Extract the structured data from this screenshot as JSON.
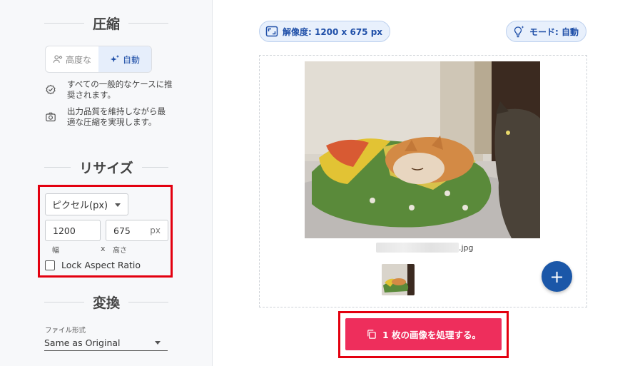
{
  "compression": {
    "title": "圧縮",
    "modes": [
      {
        "label": "高度な",
        "icon": "advanced-user-icon"
      },
      {
        "label": "自動",
        "icon": "sparkle-icon"
      }
    ],
    "active_mode": "自動",
    "features": [
      {
        "icon": "verified-badge-icon",
        "text": "すべての一般的なケースに推奨されます。"
      },
      {
        "icon": "camera-icon",
        "text": "出力品質を維持しながら最適な圧縮を実現します。"
      }
    ]
  },
  "resize": {
    "title": "リサイズ",
    "unit_select": "ピクセル(px)",
    "width_value": "1200",
    "height_value": "675",
    "height_unit": "px",
    "width_label": "幅",
    "separator": "x",
    "height_label": "高さ",
    "lock_aspect_label": "Lock Aspect Ratio",
    "lock_aspect_checked": false
  },
  "convert": {
    "title": "変換",
    "format_label": "ファイル形式",
    "format_value": "Same as Original"
  },
  "main": {
    "resolution_chip": "解像度: 1200 x 675 px",
    "mode_chip": "モード: 自動",
    "file_extension": ".jpg",
    "add_button": "+",
    "process_button": "1 枚の画像を処理する。"
  },
  "colors": {
    "accent_blue": "#1b57a8",
    "process_pink": "#ee2e5c",
    "highlight_red": "#e3000f"
  }
}
